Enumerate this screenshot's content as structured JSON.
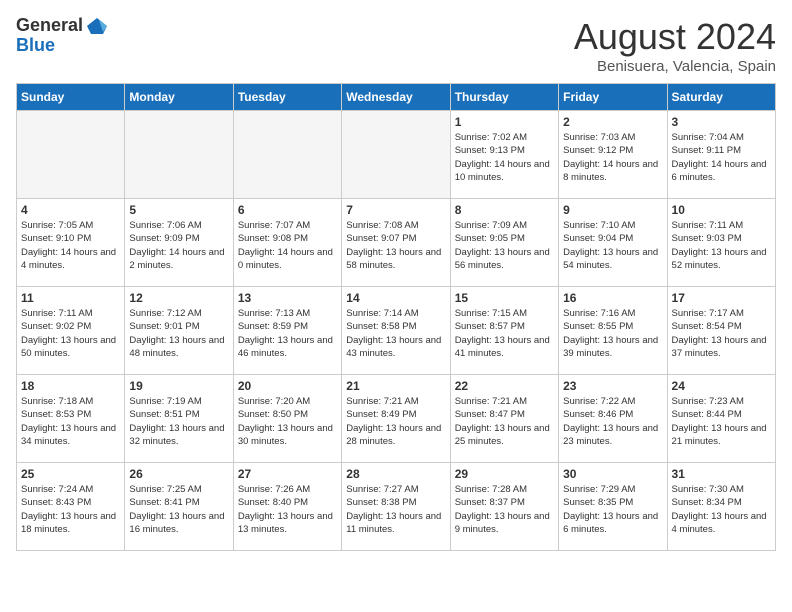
{
  "logo": {
    "line1": "General",
    "line2": "Blue"
  },
  "title": "August 2024",
  "location": "Benisuera, Valencia, Spain",
  "days_of_week": [
    "Sunday",
    "Monday",
    "Tuesday",
    "Wednesday",
    "Thursday",
    "Friday",
    "Saturday"
  ],
  "weeks": [
    [
      {
        "day": "",
        "empty": true
      },
      {
        "day": "",
        "empty": true
      },
      {
        "day": "",
        "empty": true
      },
      {
        "day": "",
        "empty": true
      },
      {
        "day": "1",
        "sunrise": "7:02 AM",
        "sunset": "9:13 PM",
        "daylight": "14 hours and 10 minutes."
      },
      {
        "day": "2",
        "sunrise": "7:03 AM",
        "sunset": "9:12 PM",
        "daylight": "14 hours and 8 minutes."
      },
      {
        "day": "3",
        "sunrise": "7:04 AM",
        "sunset": "9:11 PM",
        "daylight": "14 hours and 6 minutes."
      }
    ],
    [
      {
        "day": "4",
        "sunrise": "7:05 AM",
        "sunset": "9:10 PM",
        "daylight": "14 hours and 4 minutes."
      },
      {
        "day": "5",
        "sunrise": "7:06 AM",
        "sunset": "9:09 PM",
        "daylight": "14 hours and 2 minutes."
      },
      {
        "day": "6",
        "sunrise": "7:07 AM",
        "sunset": "9:08 PM",
        "daylight": "14 hours and 0 minutes."
      },
      {
        "day": "7",
        "sunrise": "7:08 AM",
        "sunset": "9:07 PM",
        "daylight": "13 hours and 58 minutes."
      },
      {
        "day": "8",
        "sunrise": "7:09 AM",
        "sunset": "9:05 PM",
        "daylight": "13 hours and 56 minutes."
      },
      {
        "day": "9",
        "sunrise": "7:10 AM",
        "sunset": "9:04 PM",
        "daylight": "13 hours and 54 minutes."
      },
      {
        "day": "10",
        "sunrise": "7:11 AM",
        "sunset": "9:03 PM",
        "daylight": "13 hours and 52 minutes."
      }
    ],
    [
      {
        "day": "11",
        "sunrise": "7:11 AM",
        "sunset": "9:02 PM",
        "daylight": "13 hours and 50 minutes."
      },
      {
        "day": "12",
        "sunrise": "7:12 AM",
        "sunset": "9:01 PM",
        "daylight": "13 hours and 48 minutes."
      },
      {
        "day": "13",
        "sunrise": "7:13 AM",
        "sunset": "8:59 PM",
        "daylight": "13 hours and 46 minutes."
      },
      {
        "day": "14",
        "sunrise": "7:14 AM",
        "sunset": "8:58 PM",
        "daylight": "13 hours and 43 minutes."
      },
      {
        "day": "15",
        "sunrise": "7:15 AM",
        "sunset": "8:57 PM",
        "daylight": "13 hours and 41 minutes."
      },
      {
        "day": "16",
        "sunrise": "7:16 AM",
        "sunset": "8:55 PM",
        "daylight": "13 hours and 39 minutes."
      },
      {
        "day": "17",
        "sunrise": "7:17 AM",
        "sunset": "8:54 PM",
        "daylight": "13 hours and 37 minutes."
      }
    ],
    [
      {
        "day": "18",
        "sunrise": "7:18 AM",
        "sunset": "8:53 PM",
        "daylight": "13 hours and 34 minutes."
      },
      {
        "day": "19",
        "sunrise": "7:19 AM",
        "sunset": "8:51 PM",
        "daylight": "13 hours and 32 minutes."
      },
      {
        "day": "20",
        "sunrise": "7:20 AM",
        "sunset": "8:50 PM",
        "daylight": "13 hours and 30 minutes."
      },
      {
        "day": "21",
        "sunrise": "7:21 AM",
        "sunset": "8:49 PM",
        "daylight": "13 hours and 28 minutes."
      },
      {
        "day": "22",
        "sunrise": "7:21 AM",
        "sunset": "8:47 PM",
        "daylight": "13 hours and 25 minutes."
      },
      {
        "day": "23",
        "sunrise": "7:22 AM",
        "sunset": "8:46 PM",
        "daylight": "13 hours and 23 minutes."
      },
      {
        "day": "24",
        "sunrise": "7:23 AM",
        "sunset": "8:44 PM",
        "daylight": "13 hours and 21 minutes."
      }
    ],
    [
      {
        "day": "25",
        "sunrise": "7:24 AM",
        "sunset": "8:43 PM",
        "daylight": "13 hours and 18 minutes."
      },
      {
        "day": "26",
        "sunrise": "7:25 AM",
        "sunset": "8:41 PM",
        "daylight": "13 hours and 16 minutes."
      },
      {
        "day": "27",
        "sunrise": "7:26 AM",
        "sunset": "8:40 PM",
        "daylight": "13 hours and 13 minutes."
      },
      {
        "day": "28",
        "sunrise": "7:27 AM",
        "sunset": "8:38 PM",
        "daylight": "13 hours and 11 minutes."
      },
      {
        "day": "29",
        "sunrise": "7:28 AM",
        "sunset": "8:37 PM",
        "daylight": "13 hours and 9 minutes."
      },
      {
        "day": "30",
        "sunrise": "7:29 AM",
        "sunset": "8:35 PM",
        "daylight": "13 hours and 6 minutes."
      },
      {
        "day": "31",
        "sunrise": "7:30 AM",
        "sunset": "8:34 PM",
        "daylight": "13 hours and 4 minutes."
      }
    ]
  ]
}
